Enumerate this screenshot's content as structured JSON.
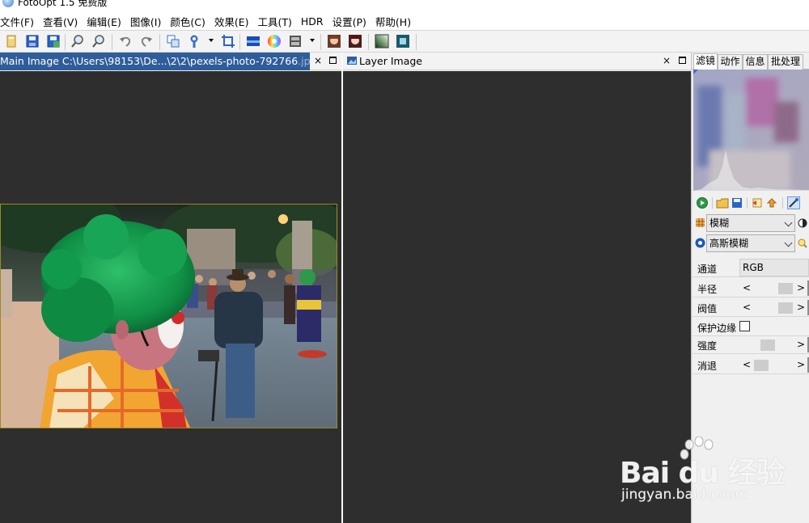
{
  "window": {
    "title": "FotoOpt 1.5 免费版"
  },
  "menu": {
    "items": [
      "文件(F)",
      "查看(V)",
      "编辑(E)",
      "图像(I)",
      "颜色(C)",
      "效果(E)",
      "工具(T)",
      "HDR",
      "设置(P)",
      "帮助(H)"
    ]
  },
  "toolbar": {
    "icons": [
      "new-icon",
      "save-icon",
      "save-as-icon",
      "zoom-in-icon",
      "zoom-out-icon",
      "undo-icon",
      "redo-icon",
      "copy-layer-icon",
      "brush-icon",
      "crop-icon",
      "levels-icon",
      "color-wheel-icon",
      "filmstrip-icon",
      "portrait-icon",
      "portrait2-icon",
      "gradient-icon",
      "enhance-icon"
    ]
  },
  "main_tab": {
    "title": "Main Image C:\\Users\\98153\\De...\\2\\2\\pexels-photo-792766",
    "title_faded": ".jpg",
    "close": "×"
  },
  "layer_tab": {
    "title": "Layer Image",
    "close": "×"
  },
  "right_panel": {
    "tabs": [
      "滤镜",
      "动作",
      "信息",
      "批处理"
    ],
    "active_tab": 0,
    "filter_category": "模糊",
    "filter_name": "高斯模糊",
    "params": {
      "channel_label": "通道",
      "channel_value": "RGB",
      "radius_label": "半径",
      "threshold_label": "阀值",
      "protect_edges_label": "保护边缘",
      "protect_edges_checked": false,
      "strength_label": "强度",
      "fade_label": "消退",
      "arrow_left": "<",
      "arrow_right": ">"
    }
  },
  "watermark": {
    "main": "Bai du 经验",
    "sub": "jingyan.baidu.com"
  },
  "colors": {
    "accent_tab": "#2f5d9a",
    "canvas": "#2e2e2e"
  }
}
